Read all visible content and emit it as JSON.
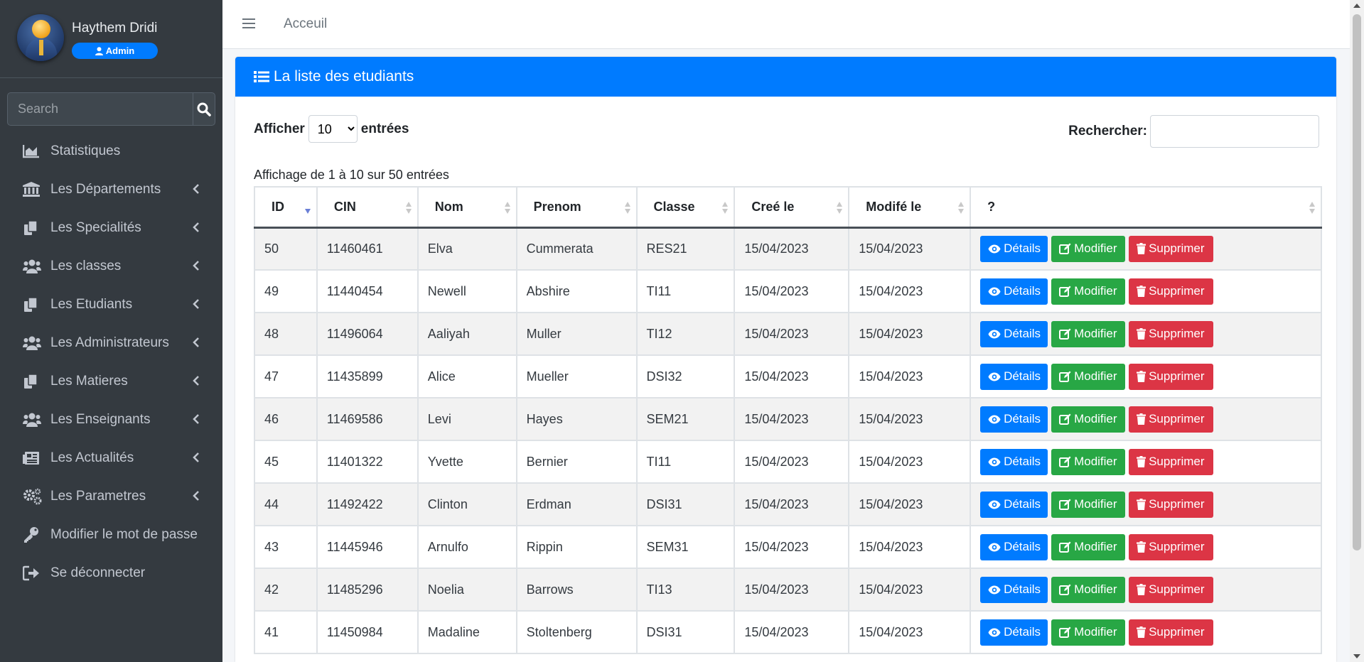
{
  "user": {
    "name": "Haythem Dridi",
    "role": "Admin"
  },
  "sidebar_search": {
    "placeholder": "Search"
  },
  "nav": [
    {
      "label": "Statistiques",
      "icon": "chart-area-icon",
      "chevron": false
    },
    {
      "label": "Les Départements",
      "icon": "university-icon",
      "chevron": true
    },
    {
      "label": "Les Specialités",
      "icon": "copy-icon",
      "chevron": true
    },
    {
      "label": "Les classes",
      "icon": "users-icon",
      "chevron": true
    },
    {
      "label": "Les Etudiants",
      "icon": "copy-icon",
      "chevron": true
    },
    {
      "label": "Les Administrateurs",
      "icon": "users-icon",
      "chevron": true
    },
    {
      "label": "Les Matieres",
      "icon": "copy-icon",
      "chevron": true
    },
    {
      "label": "Les Enseignants",
      "icon": "users-icon",
      "chevron": true
    },
    {
      "label": "Les Actualités",
      "icon": "newspaper-icon",
      "chevron": true
    },
    {
      "label": "Les Parametres",
      "icon": "cogs-icon",
      "chevron": true
    },
    {
      "label": "Modifier le mot de passe",
      "icon": "key-icon",
      "chevron": false
    },
    {
      "label": "Se déconnecter",
      "icon": "sign-out-icon",
      "chevron": false
    }
  ],
  "topbar": {
    "home_label": "Acceuil"
  },
  "card": {
    "title": "La liste des etudiants"
  },
  "controls": {
    "show_label": "Afficher",
    "page_length": "10",
    "entries_label": "entrées",
    "search_label": "Rechercher:"
  },
  "info": "Affichage de 1 à 10 sur 50 entrées",
  "table": {
    "columns": [
      "ID",
      "CIN",
      "Nom",
      "Prenom",
      "Classe",
      "Creé le",
      "Modifé le",
      "?"
    ],
    "rows": [
      [
        "50",
        "11460461",
        "Elva",
        "Cummerata",
        "RES21",
        "15/04/2023",
        "15/04/2023"
      ],
      [
        "49",
        "11440454",
        "Newell",
        "Abshire",
        "TI11",
        "15/04/2023",
        "15/04/2023"
      ],
      [
        "48",
        "11496064",
        "Aaliyah",
        "Muller",
        "TI12",
        "15/04/2023",
        "15/04/2023"
      ],
      [
        "47",
        "11435899",
        "Alice",
        "Mueller",
        "DSI32",
        "15/04/2023",
        "15/04/2023"
      ],
      [
        "46",
        "11469586",
        "Levi",
        "Hayes",
        "SEM21",
        "15/04/2023",
        "15/04/2023"
      ],
      [
        "45",
        "11401322",
        "Yvette",
        "Bernier",
        "TI11",
        "15/04/2023",
        "15/04/2023"
      ],
      [
        "44",
        "11492422",
        "Clinton",
        "Erdman",
        "DSI31",
        "15/04/2023",
        "15/04/2023"
      ],
      [
        "43",
        "11445946",
        "Arnulfo",
        "Rippin",
        "SEM31",
        "15/04/2023",
        "15/04/2023"
      ],
      [
        "42",
        "11485296",
        "Noelia",
        "Barrows",
        "TI13",
        "15/04/2023",
        "15/04/2023"
      ],
      [
        "41",
        "11450984",
        "Madaline",
        "Stoltenberg",
        "DSI31",
        "15/04/2023",
        "15/04/2023"
      ]
    ],
    "actions": {
      "details": "Détails",
      "edit": "Modifier",
      "delete": "Supprimer"
    }
  },
  "colors": {
    "primary": "#007bff",
    "success": "#28a745",
    "danger": "#dc3545",
    "sidebar": "#343a40"
  }
}
